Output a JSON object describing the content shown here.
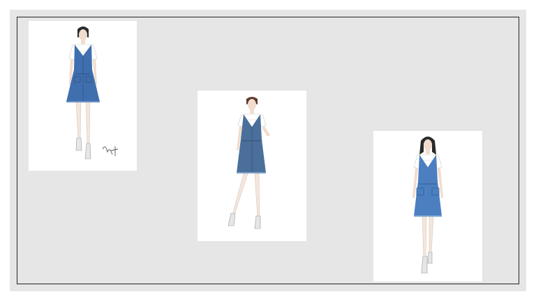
{
  "slide": {
    "background": "#e6e6e6",
    "border_color": "#222222"
  },
  "illustrations": [
    {
      "id": "sketch-1",
      "dress_color": "#3f6fae",
      "shirt_color": "#ffffff",
      "has_signature": true
    },
    {
      "id": "sketch-2",
      "dress_color": "#4a6f9a",
      "shirt_color": "#ffffff",
      "has_signature": false
    },
    {
      "id": "sketch-3",
      "dress_color": "#4b7fc0",
      "shirt_color": "#ffffff",
      "has_signature": false
    }
  ]
}
